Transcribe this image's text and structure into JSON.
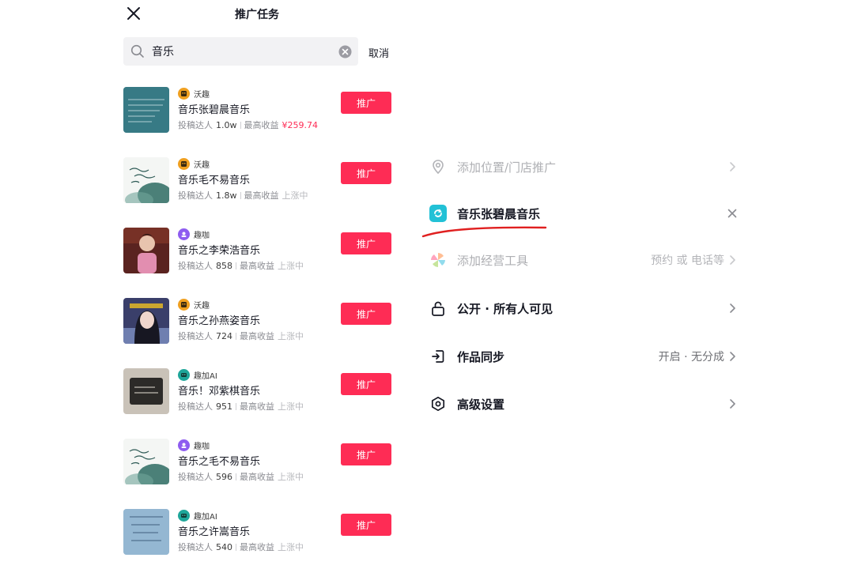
{
  "header": {
    "title": "推广任务",
    "close_icon": "close-icon"
  },
  "search": {
    "value": "音乐",
    "cancel_label": "取消",
    "search_icon": "search-icon",
    "clear_icon": "clear-icon"
  },
  "tasks": [
    {
      "publisher": "沃趣",
      "publisher_color": "#f0a020",
      "title": "音乐张碧晨音乐",
      "submit_label": "投稿达人",
      "submit_count": "1.0w",
      "income_label": "最高收益",
      "income_value": "¥259.74",
      "status": "",
      "button": "推广"
    },
    {
      "publisher": "沃趣",
      "publisher_color": "#f0a020",
      "title": "音乐毛不易音乐",
      "submit_label": "投稿达人",
      "submit_count": "1.8w",
      "income_label": "最高收益",
      "income_value": "",
      "status": "上涨中",
      "button": "推广"
    },
    {
      "publisher": "趣咖",
      "publisher_color": "#8e5cf0",
      "title": "音乐之李荣浩音乐",
      "submit_label": "投稿达人",
      "submit_count": "858",
      "income_label": "最高收益",
      "income_value": "",
      "status": "上涨中",
      "button": "推广"
    },
    {
      "publisher": "沃趣",
      "publisher_color": "#f0a020",
      "title": "音乐之孙燕姿音乐",
      "submit_label": "投稿达人",
      "submit_count": "724",
      "income_label": "最高收益",
      "income_value": "",
      "status": "上涨中",
      "button": "推广"
    },
    {
      "publisher": "趣加AI",
      "publisher_color": "#1fa69a",
      "title": "音乐！邓紫棋音乐",
      "submit_label": "投稿达人",
      "submit_count": "951",
      "income_label": "最高收益",
      "income_value": "",
      "status": "上涨中",
      "button": "推广"
    },
    {
      "publisher": "趣咖",
      "publisher_color": "#8e5cf0",
      "title": "音乐之毛不易音乐",
      "submit_label": "投稿达人",
      "submit_count": "596",
      "income_label": "最高收益",
      "income_value": "",
      "status": "上涨中",
      "button": "推广"
    },
    {
      "publisher": "趣加AI",
      "publisher_color": "#1fa69a",
      "title": "音乐之许嵩音乐",
      "submit_label": "投稿达人",
      "submit_count": "540",
      "income_label": "最高收益",
      "income_value": "",
      "status": "上涨中",
      "button": "推广"
    }
  ],
  "settings": {
    "location": {
      "label": "添加位置/门店推广",
      "icon": "location-pin-icon"
    },
    "selected_task": {
      "label": "音乐张碧晨音乐",
      "icon": "task-link-icon",
      "remove_icon": "close-icon"
    },
    "business_tools": {
      "label": "添加经营工具",
      "value": "预约 或 电话等",
      "icon": "pinwheel-icon"
    },
    "visibility": {
      "label": "公开 · 所有人可见",
      "icon": "unlock-icon"
    },
    "sync": {
      "label": "作品同步",
      "value": "开启 · 无分成",
      "icon": "sync-exit-icon"
    },
    "advanced": {
      "label": "高级设置",
      "icon": "hexagon-settings-icon"
    }
  },
  "colors": {
    "accent": "#fe2c55",
    "annotation": "#e02020",
    "selected_icon": "#22c1d6"
  }
}
